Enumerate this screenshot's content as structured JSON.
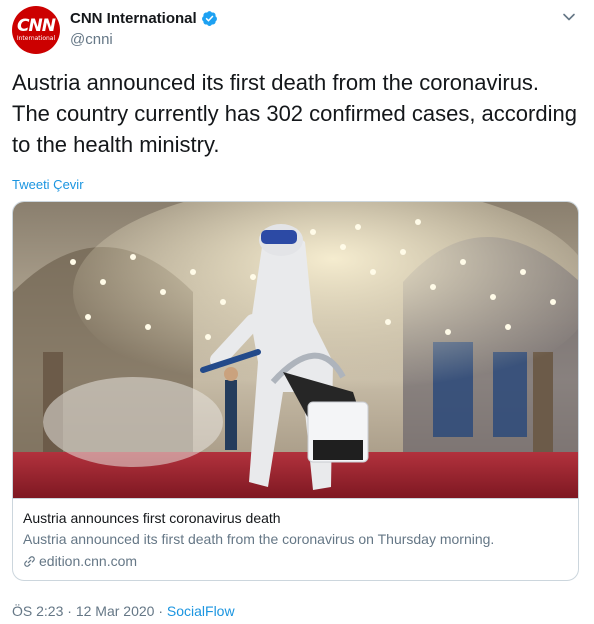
{
  "author": {
    "display_name": "CNN International",
    "handle": "@cnni",
    "avatar_logo": "CNN",
    "avatar_sub": "International",
    "verified_icon": "verified-badge-icon",
    "accent_color": "#1da1f2",
    "brand_color": "#cc0000"
  },
  "tweet": {
    "text": "Austria announced its first death from the coronavirus. The country currently has 302 confirmed cases, according to the health ministry.",
    "translate_label": "Tweeti Çevir"
  },
  "card": {
    "title": "Austria announces first coronavirus death",
    "description": "Austria announced its first death from the coronavirus on Thursday morning.",
    "domain": "edition.cnn.com",
    "image_caption": "Worker in protective suit disinfecting a mosque interior"
  },
  "meta": {
    "time": "ÖS 2:23",
    "separator": "·",
    "date": "12 Mar 2020",
    "source": "SocialFlow"
  },
  "icons": {
    "caret": "chevron-down-icon",
    "link": "link-icon"
  }
}
